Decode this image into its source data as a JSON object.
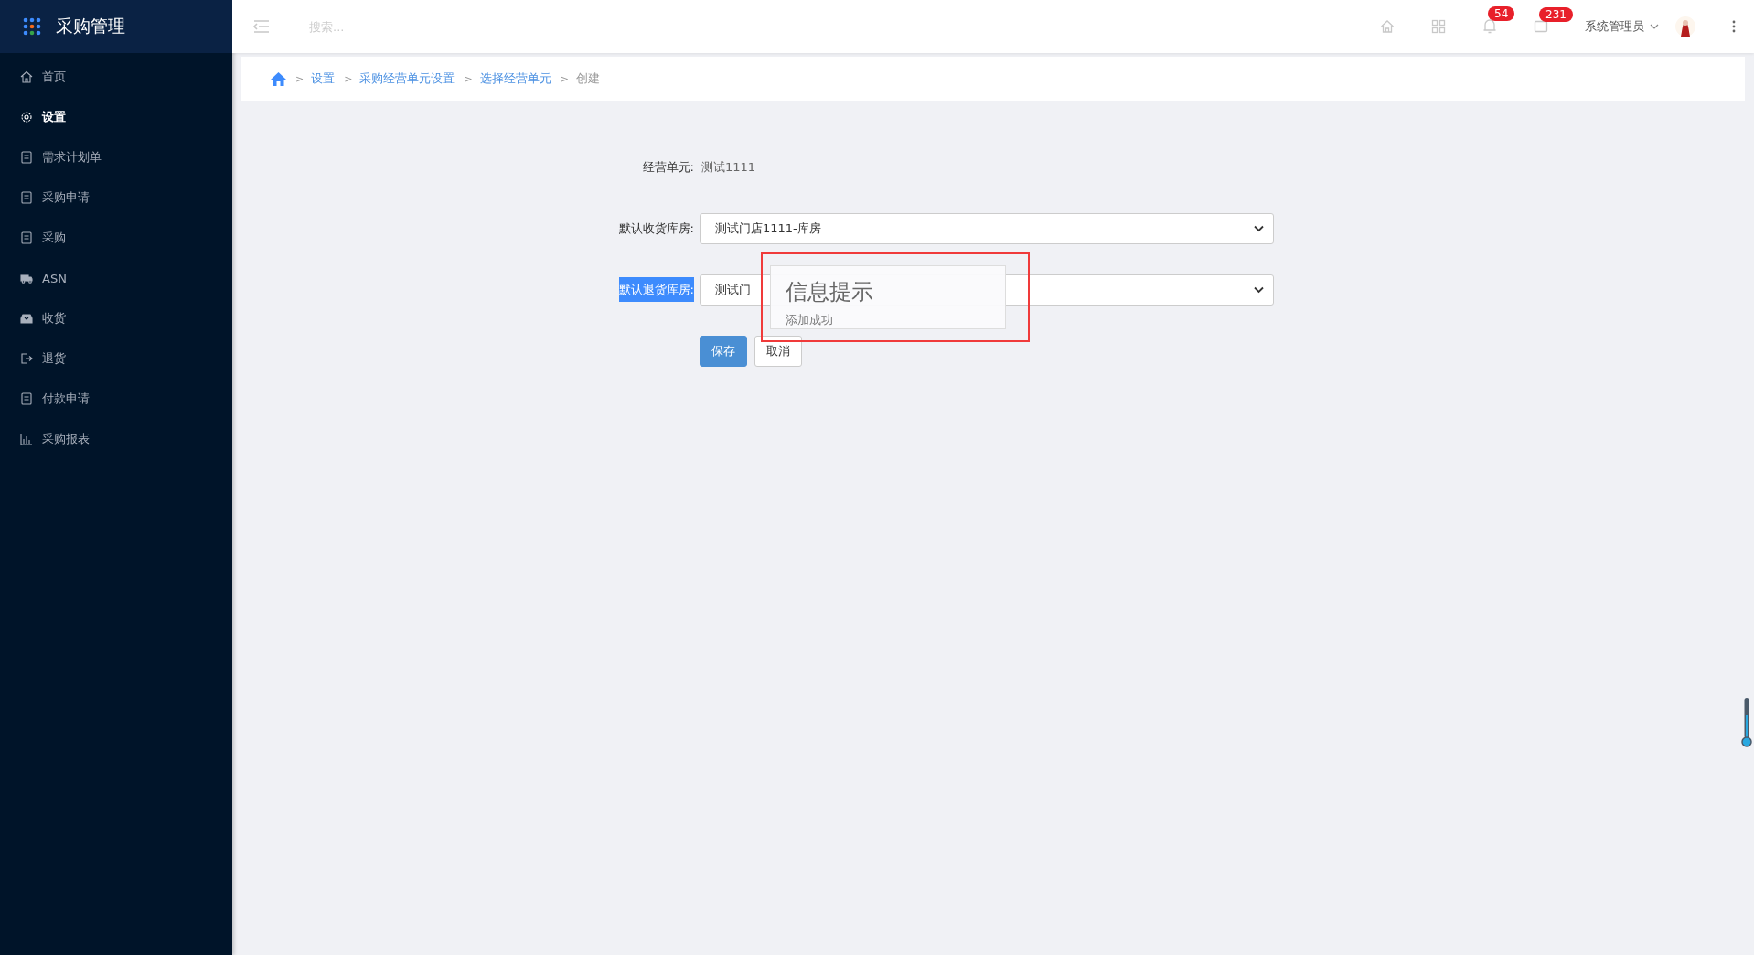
{
  "sidebar": {
    "title": "采购管理",
    "items": [
      {
        "label": "首页",
        "selected": false
      },
      {
        "label": "设置",
        "selected": true
      },
      {
        "label": "需求计划单",
        "selected": false
      },
      {
        "label": "采购申请",
        "selected": false
      },
      {
        "label": "采购",
        "selected": false
      },
      {
        "label": "ASN",
        "selected": false
      },
      {
        "label": "收货",
        "selected": false
      },
      {
        "label": "退货",
        "selected": false
      },
      {
        "label": "付款申请",
        "selected": false
      },
      {
        "label": "采购报表",
        "selected": false
      }
    ]
  },
  "header": {
    "search": {
      "placeholder": "搜索..."
    },
    "notifications": "54",
    "messages": "231",
    "user": "系统管理员"
  },
  "breadcrumb": [
    {
      "separator": ">",
      "label": "设置",
      "link": true
    },
    {
      "separator": ">",
      "label": "采购经营单元设置",
      "link": true
    },
    {
      "separator": ">",
      "label": "选择经营单元",
      "link": true
    },
    {
      "separator": ">",
      "label": "创建",
      "link": false
    }
  ],
  "form": {
    "rows": [
      {
        "kind": "text",
        "label": "经营单元:",
        "value": "测试1111",
        "highlighted": false
      },
      {
        "kind": "select",
        "label": "默认收货库房:",
        "value": "测试门店1111-库房",
        "highlighted": false
      },
      {
        "kind": "select",
        "label": "默认退货库房:",
        "value": "测试门",
        "highlighted": true
      }
    ],
    "buttons": [
      {
        "label": "保存",
        "primary": true
      },
      {
        "label": "取消",
        "primary": false
      }
    ]
  },
  "dialog": {
    "title": "信息提示",
    "message": "添加成功"
  }
}
